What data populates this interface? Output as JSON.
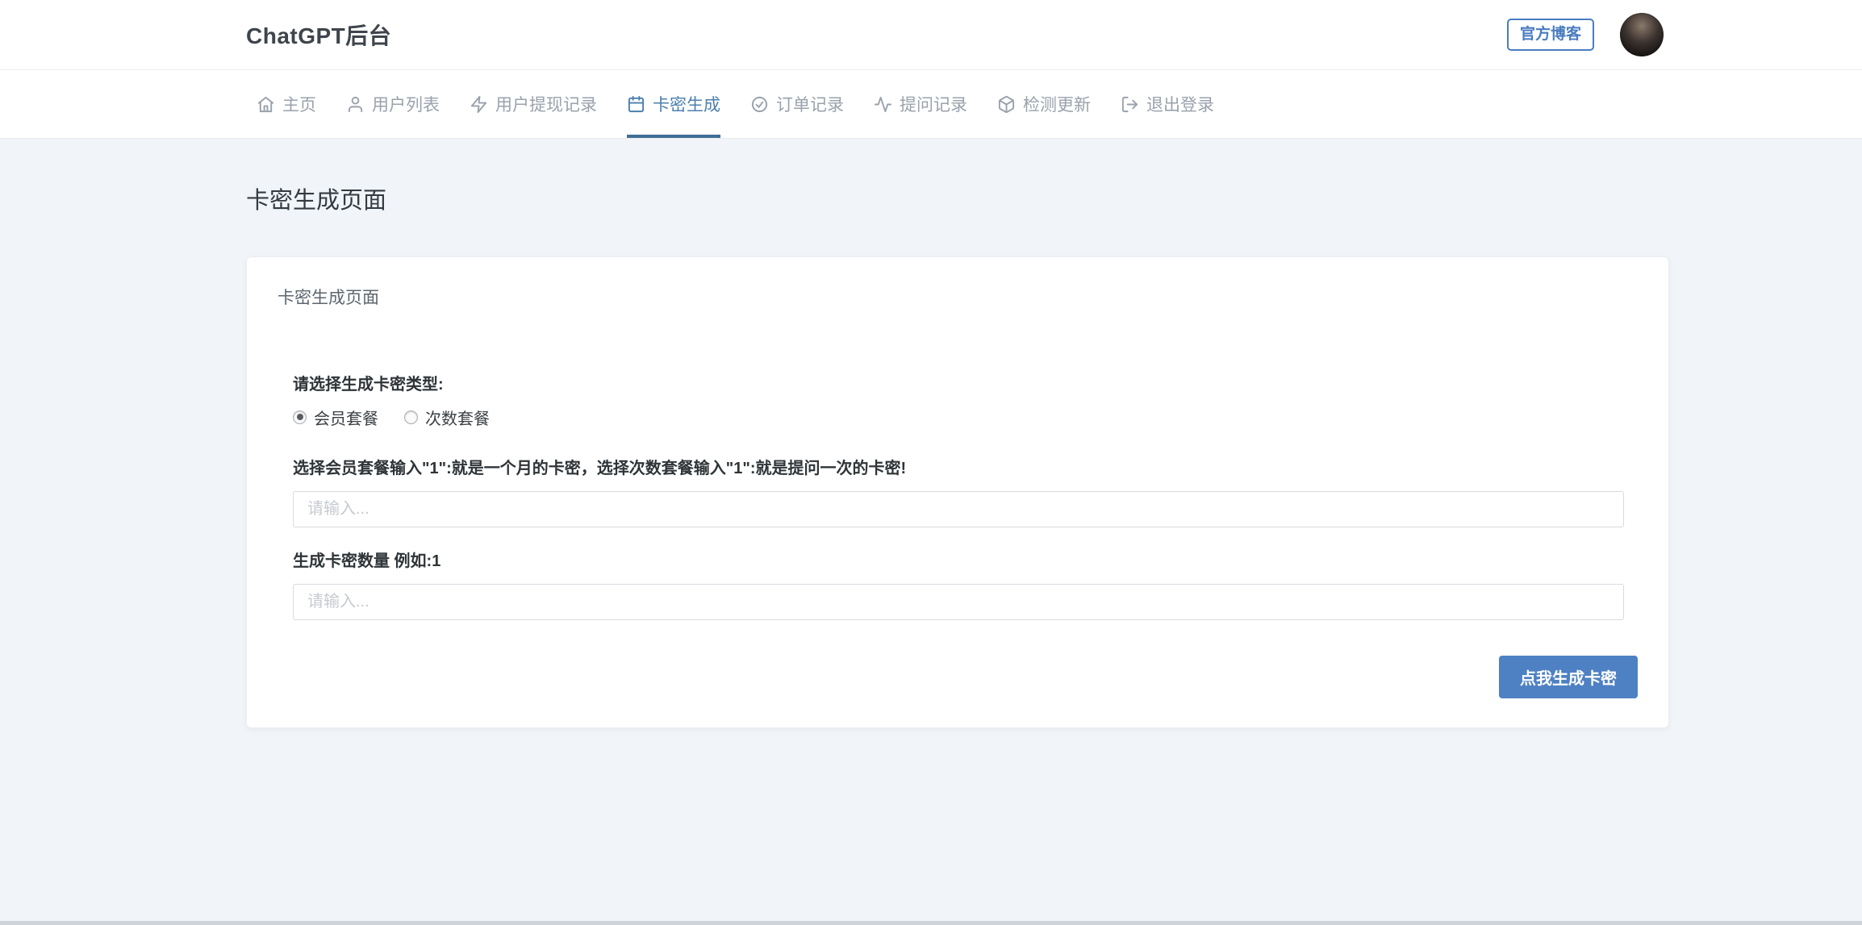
{
  "header": {
    "title": "ChatGPT后台",
    "blog_button": "官方博客"
  },
  "nav": {
    "items": [
      {
        "label": "主页",
        "icon": "home-icon",
        "active": false
      },
      {
        "label": "用户列表",
        "icon": "user-icon",
        "active": false
      },
      {
        "label": "用户提现记录",
        "icon": "zap-icon",
        "active": false
      },
      {
        "label": "卡密生成",
        "icon": "calendar-icon",
        "active": true
      },
      {
        "label": "订单记录",
        "icon": "check-circle-icon",
        "active": false
      },
      {
        "label": "提问记录",
        "icon": "activity-icon",
        "active": false
      },
      {
        "label": "检测更新",
        "icon": "package-icon",
        "active": false
      },
      {
        "label": "退出登录",
        "icon": "logout-icon",
        "active": false
      }
    ]
  },
  "page": {
    "title": "卡密生成页面"
  },
  "card": {
    "title": "卡密生成页面",
    "type_label": "请选择生成卡密类型:",
    "radios": [
      {
        "label": "会员套餐",
        "checked": true
      },
      {
        "label": "次数套餐",
        "checked": false
      }
    ],
    "hint_label": "选择会员套餐输入\"1\":就是一个月的卡密，选择次数套餐输入\"1\":就是提问一次的卡密!",
    "value_input": {
      "placeholder": "请输入...",
      "value": ""
    },
    "count_label": "生成卡密数量 例如:1",
    "count_input": {
      "placeholder": "请输入...",
      "value": ""
    },
    "submit_button": "点我生成卡密"
  },
  "colors": {
    "accent_blue": "#4a7cc0",
    "active_tab_blue": "#4c7fae",
    "active_underline": "#3d6f96",
    "button_blue": "#4e81c3",
    "page_background": "#f1f4f8"
  }
}
